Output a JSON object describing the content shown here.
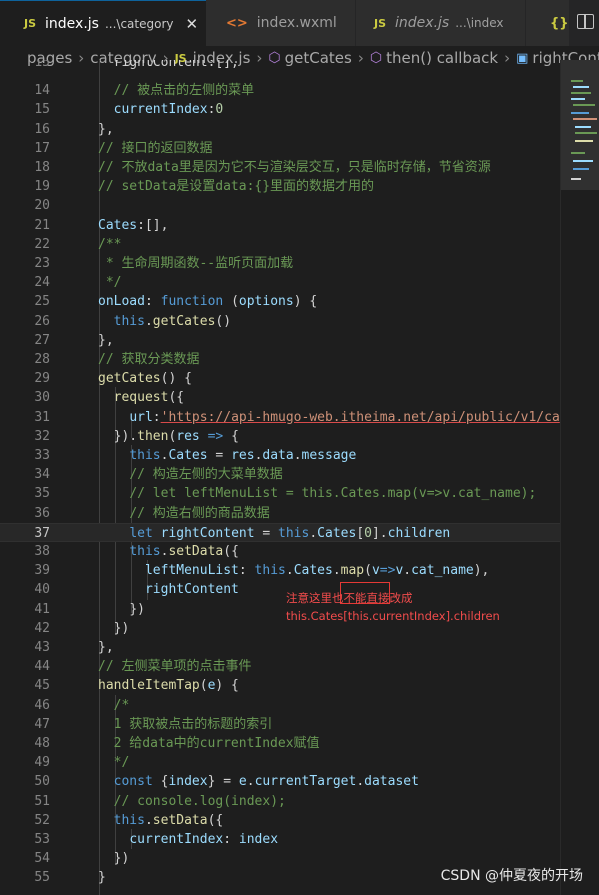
{
  "tabs": [
    {
      "icon": "JS",
      "name": "index.js",
      "desc": "...\\category",
      "close": "✕",
      "active": true,
      "italic": false
    },
    {
      "icon": "<>",
      "name": "index.wxml",
      "desc": "",
      "close": "",
      "active": false,
      "italic": false
    },
    {
      "icon": "JS",
      "name": "index.js",
      "desc": "...\\index",
      "close": "",
      "active": false,
      "italic": true
    },
    {
      "icon": "{}",
      "name": "",
      "desc": "",
      "close": "",
      "active": false,
      "italic": false
    }
  ],
  "breadcrumb": {
    "pages": "pages",
    "sep": "›",
    "category": "category",
    "file_icon": "JS",
    "file": "index.js",
    "fn1": "getCates",
    "fn2": "then() callback",
    "field": "rightConte"
  },
  "lines": [
    {
      "n": "15",
      "tokens": [
        [
          "  ",
          ""
        ],
        [
          "rightContent",
          ""
        ],
        [
          ":[],",
          "p"
        ]
      ]
    },
    {
      "n": "14",
      "tokens": [
        [
          "  ",
          ""
        ],
        [
          "// 被点击的左侧的菜单",
          "c"
        ]
      ]
    },
    {
      "n": "15",
      "tokens": [
        [
          "  ",
          ""
        ],
        [
          "currentIndex",
          "v"
        ],
        [
          ":",
          "p"
        ],
        [
          "0",
          "n"
        ]
      ]
    },
    {
      "n": "16",
      "tokens": [
        [
          "},",
          "p"
        ]
      ]
    },
    {
      "n": "17",
      "tokens": [
        [
          "// 接口的返回数据",
          "c"
        ]
      ]
    },
    {
      "n": "18",
      "tokens": [
        [
          "// 不放data里是因为它不与渲染层交互，只是临时存储，节省资源",
          "c"
        ]
      ]
    },
    {
      "n": "19",
      "tokens": [
        [
          "// setData是设置data:{}里面的数据才用的",
          "c"
        ]
      ]
    },
    {
      "n": "20",
      "tokens": []
    },
    {
      "n": "21",
      "tokens": [
        [
          "Cates",
          "v"
        ],
        [
          ":[],",
          "p"
        ]
      ]
    },
    {
      "n": "22",
      "tokens": [
        [
          "/**",
          "c"
        ]
      ]
    },
    {
      "n": "23",
      "tokens": [
        [
          " * 生命周期函数--监听页面加载",
          "c"
        ]
      ]
    },
    {
      "n": "24",
      "tokens": [
        [
          " */",
          "c"
        ]
      ]
    },
    {
      "n": "25",
      "tokens": [
        [
          "onLoad",
          "v"
        ],
        [
          ": ",
          "p"
        ],
        [
          "function",
          "k"
        ],
        [
          " (",
          "p"
        ],
        [
          "options",
          "v"
        ],
        [
          ") {",
          "p"
        ]
      ]
    },
    {
      "n": "26",
      "tokens": [
        [
          "  ",
          ""
        ],
        [
          "this",
          "k"
        ],
        [
          ".",
          "p"
        ],
        [
          "getCates",
          "f"
        ],
        [
          "()",
          "p"
        ]
      ]
    },
    {
      "n": "27",
      "tokens": [
        [
          "},",
          "p"
        ]
      ]
    },
    {
      "n": "28",
      "tokens": [
        [
          "// 获取分类数据",
          "c"
        ]
      ]
    },
    {
      "n": "29",
      "tokens": [
        [
          "getCates",
          "f"
        ],
        [
          "() {",
          "p"
        ]
      ]
    },
    {
      "n": "30",
      "tokens": [
        [
          "  ",
          ""
        ],
        [
          "request",
          "f"
        ],
        [
          "({",
          "p"
        ]
      ]
    },
    {
      "n": "31",
      "tokens": [
        [
          "    ",
          ""
        ],
        [
          "url",
          "v"
        ],
        [
          ":",
          "p"
        ],
        [
          "'https://api-hmugo-web.itheima.net/api/public/v1/ca",
          "s"
        ]
      ]
    },
    {
      "n": "32",
      "tokens": [
        [
          "  ",
          ""
        ],
        [
          "}).",
          "p"
        ],
        [
          "then",
          "f"
        ],
        [
          "(",
          "p"
        ],
        [
          "res",
          "v"
        ],
        [
          " => ",
          "k"
        ],
        [
          "{",
          "p"
        ]
      ]
    },
    {
      "n": "33",
      "tokens": [
        [
          "    ",
          ""
        ],
        [
          "this",
          "k"
        ],
        [
          ".",
          "p"
        ],
        [
          "Cates",
          "v"
        ],
        [
          " = ",
          "p"
        ],
        [
          "res",
          "v"
        ],
        [
          ".",
          "p"
        ],
        [
          "data",
          "v"
        ],
        [
          ".",
          "p"
        ],
        [
          "message",
          "v"
        ]
      ]
    },
    {
      "n": "34",
      "tokens": [
        [
          "    ",
          ""
        ],
        [
          "// 构造左侧的大菜单数据",
          "c"
        ]
      ]
    },
    {
      "n": "35",
      "tokens": [
        [
          "    ",
          ""
        ],
        [
          "// let leftMenuList = this.Cates.map(v=>v.cat_name);",
          "c"
        ]
      ]
    },
    {
      "n": "36",
      "tokens": [
        [
          "    ",
          ""
        ],
        [
          "// 构造右侧的商品数据",
          "c"
        ]
      ]
    },
    {
      "n": "37",
      "tokens": [
        [
          "    ",
          ""
        ],
        [
          "let",
          "k"
        ],
        [
          " ",
          "p"
        ],
        [
          "rightContent",
          "v"
        ],
        [
          " = ",
          "p"
        ],
        [
          "this",
          "k"
        ],
        [
          ".",
          "p"
        ],
        [
          "Cates",
          "v"
        ],
        [
          "[",
          "p"
        ],
        [
          "0",
          "n"
        ],
        [
          "].",
          "p"
        ],
        [
          "children",
          "v"
        ]
      ]
    },
    {
      "n": "38",
      "tokens": [
        [
          "    ",
          ""
        ],
        [
          "this",
          "k"
        ],
        [
          ".",
          "p"
        ],
        [
          "setData",
          "f"
        ],
        [
          "({",
          "p"
        ]
      ]
    },
    {
      "n": "39",
      "tokens": [
        [
          "      ",
          ""
        ],
        [
          "leftMenuList",
          "v"
        ],
        [
          ": ",
          "p"
        ],
        [
          "this",
          "k"
        ],
        [
          ".",
          "p"
        ],
        [
          "Cates",
          "v"
        ],
        [
          ".",
          "p"
        ],
        [
          "map",
          "f"
        ],
        [
          "(",
          "p"
        ],
        [
          "v",
          "v"
        ],
        [
          "=>",
          "k"
        ],
        [
          "v",
          "v"
        ],
        [
          ".",
          "p"
        ],
        [
          "cat_name",
          "v"
        ],
        [
          "),",
          "p"
        ]
      ]
    },
    {
      "n": "40",
      "tokens": [
        [
          "      ",
          ""
        ],
        [
          "rightContent",
          "v"
        ]
      ]
    },
    {
      "n": "41",
      "tokens": [
        [
          "    ",
          ""
        ],
        [
          "})",
          "p"
        ]
      ]
    },
    {
      "n": "42",
      "tokens": [
        [
          "  ",
          ""
        ],
        [
          "})",
          "p"
        ]
      ]
    },
    {
      "n": "43",
      "tokens": [
        [
          "},",
          "p"
        ]
      ]
    },
    {
      "n": "44",
      "tokens": [
        [
          "// 左侧菜单项的点击事件",
          "c"
        ]
      ]
    },
    {
      "n": "45",
      "tokens": [
        [
          "handleItemTap",
          "f"
        ],
        [
          "(",
          "p"
        ],
        [
          "e",
          "v"
        ],
        [
          ") {",
          "p"
        ]
      ]
    },
    {
      "n": "46",
      "tokens": [
        [
          "  ",
          ""
        ],
        [
          "/*",
          "c"
        ]
      ]
    },
    {
      "n": "47",
      "tokens": [
        [
          "  ",
          ""
        ],
        [
          "1 获取被点击的标题的索引",
          "c"
        ]
      ]
    },
    {
      "n": "48",
      "tokens": [
        [
          "  ",
          ""
        ],
        [
          "2 给data中的currentIndex赋值",
          "c"
        ]
      ]
    },
    {
      "n": "49",
      "tokens": [
        [
          "  ",
          ""
        ],
        [
          "*/",
          "c"
        ]
      ]
    },
    {
      "n": "50",
      "tokens": [
        [
          "  ",
          ""
        ],
        [
          "const",
          "k"
        ],
        [
          " {",
          "p"
        ],
        [
          "index",
          "v"
        ],
        [
          "} = ",
          "p"
        ],
        [
          "e",
          "v"
        ],
        [
          ".",
          "p"
        ],
        [
          "currentTarget",
          "v"
        ],
        [
          ".",
          "p"
        ],
        [
          "dataset",
          "v"
        ]
      ]
    },
    {
      "n": "51",
      "tokens": [
        [
          "  ",
          ""
        ],
        [
          "// console.log(index);",
          "c"
        ]
      ]
    },
    {
      "n": "52",
      "tokens": [
        [
          "  ",
          ""
        ],
        [
          "this",
          "k"
        ],
        [
          ".",
          "p"
        ],
        [
          "setData",
          "f"
        ],
        [
          "({",
          "p"
        ]
      ]
    },
    {
      "n": "53",
      "tokens": [
        [
          "    ",
          ""
        ],
        [
          "currentIndex",
          "v"
        ],
        [
          ": ",
          "p"
        ],
        [
          "index",
          "v"
        ]
      ]
    },
    {
      "n": "54",
      "tokens": [
        [
          "  ",
          ""
        ],
        [
          "})",
          "p"
        ]
      ]
    },
    {
      "n": "55",
      "tokens": [
        [
          "}",
          "p"
        ]
      ]
    }
  ],
  "annotation": {
    "line1": "注意这里也不能直接改成",
    "line2": "this.Cates[this.currentIndex].children"
  },
  "watermark": "CSDN @仲夏夜的开场",
  "colors": {
    "comment": "#6a9955",
    "keyword": "#569cd6",
    "variable": "#9cdcfe",
    "function": "#dcdcaa",
    "string": "#ce9178",
    "number": "#b5cea8",
    "annotation": "#f14c4c"
  }
}
